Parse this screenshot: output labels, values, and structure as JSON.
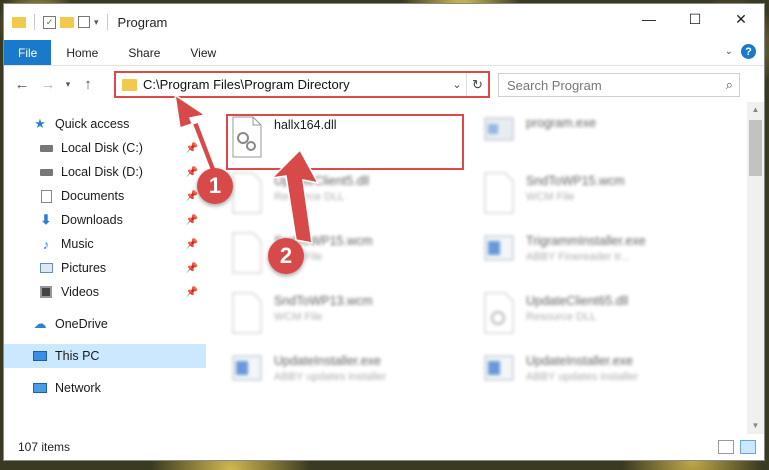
{
  "window": {
    "title": "Program"
  },
  "ribbon": {
    "tabs": [
      {
        "label": "File"
      },
      {
        "label": "Home"
      },
      {
        "label": "Share"
      },
      {
        "label": "View"
      }
    ]
  },
  "navigation": {
    "address_path": "C:\\Program Files\\Program Directory",
    "search_placeholder": "Search Program"
  },
  "sidebar": {
    "quick_access_label": "Quick access",
    "items": [
      {
        "label": "Local Disk (C:)",
        "icon": "drive-icon"
      },
      {
        "label": "Local Disk (D:)",
        "icon": "drive-icon"
      },
      {
        "label": "Documents",
        "icon": "documents-icon"
      },
      {
        "label": "Downloads",
        "icon": "downloads-icon"
      },
      {
        "label": "Music",
        "icon": "music-icon"
      },
      {
        "label": "Pictures",
        "icon": "pictures-icon"
      },
      {
        "label": "Videos",
        "icon": "videos-icon"
      }
    ],
    "onedrive_label": "OneDrive",
    "this_pc_label": "This PC",
    "network_label": "Network"
  },
  "files": {
    "highlighted": {
      "name": "hallx164.dll"
    },
    "items": [
      {
        "name": "program.exe",
        "type": ""
      },
      {
        "name": "UpdateClient5.dll",
        "type": "Resource DLL"
      },
      {
        "name": "SndToWP15.wcm",
        "type": "WCM File"
      },
      {
        "name": "SndToWP15.wcm",
        "type": "WCM File"
      },
      {
        "name": "TrigrammInstaller.exe",
        "type": "ABBY Finereader tr..."
      },
      {
        "name": "SndToWP13.wcm",
        "type": "WCM File"
      },
      {
        "name": "UpdateClient65.dll",
        "type": "Resource DLL"
      },
      {
        "name": "UpdateInstaller.exe",
        "type": "ABBY updates installer"
      },
      {
        "name": "UpdateInstaller.exe",
        "type": "ABBY updates installer"
      }
    ]
  },
  "status": {
    "item_count": "107 items"
  },
  "annotations": {
    "step1": "1",
    "step2": "2",
    "color": "#d84a4a"
  },
  "colors": {
    "accent": "#1979ca",
    "highlight_border": "#e04848",
    "selected_bg": "#cce8ff"
  }
}
